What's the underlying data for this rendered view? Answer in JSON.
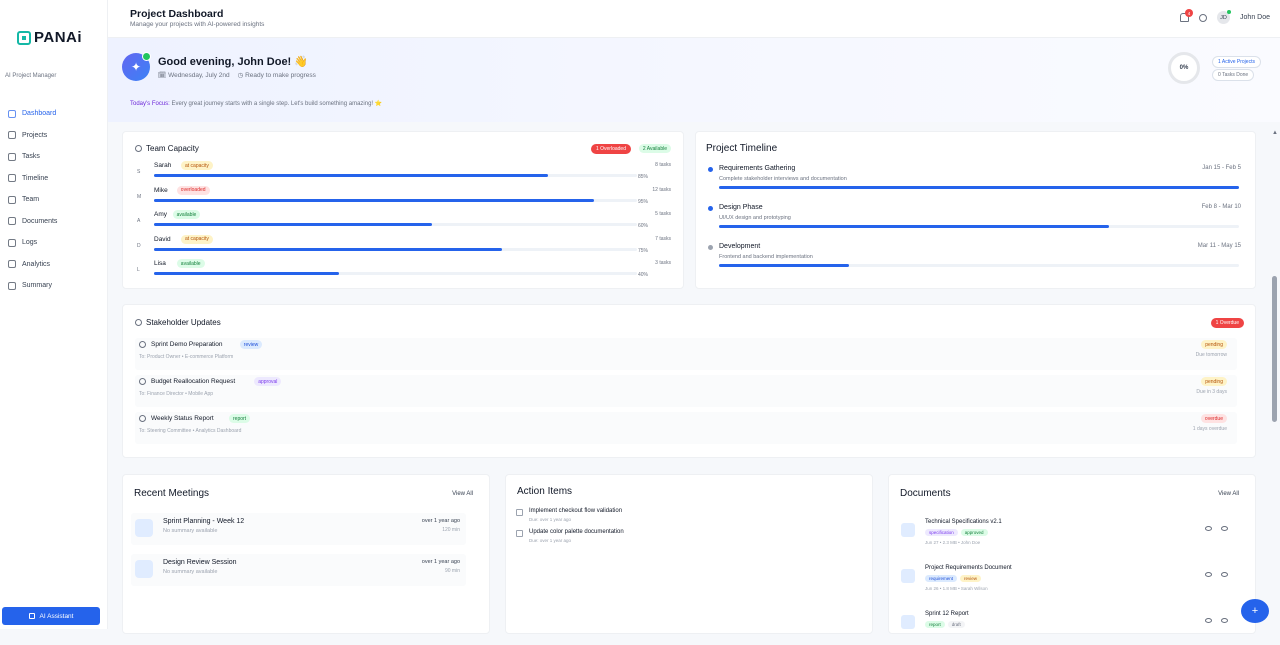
{
  "app": {
    "logo": "PANAi",
    "tagline": "AI Project Manager"
  },
  "nav": [
    {
      "label": "Dashboard",
      "active": true
    },
    {
      "label": "Projects"
    },
    {
      "label": "Tasks"
    },
    {
      "label": "Timeline"
    },
    {
      "label": "Team"
    },
    {
      "label": "Documents"
    },
    {
      "label": "Logs"
    },
    {
      "label": "Analytics"
    },
    {
      "label": "Summary"
    }
  ],
  "ai_assistant": "AI Assistant",
  "header": {
    "title": "Project Dashboard",
    "subtitle": "Manage your projects with AI-powered insights",
    "notifications": "4",
    "user_initials": "JD",
    "user_name": "John Doe"
  },
  "welcome": {
    "greeting": "Good evening, John Doe!",
    "wave": "👋",
    "date": "Wednesday, July 2nd",
    "status": "Ready to make progress",
    "focus_label": "Today's Focus:",
    "focus_text": "Every great journey starts with a single step. Let's build something amazing! ⭐",
    "progress": "0%",
    "active_projects": "1 Active Projects",
    "tasks_done": "0 Tasks Done"
  },
  "team": {
    "title": "Team Capacity",
    "overloaded": "1 Overloaded",
    "available": "2 Available",
    "members": [
      {
        "initial": "S",
        "name": "Sarah",
        "tag": "at capacity",
        "tasks": "8 tasks",
        "pct": "85%",
        "value": 85,
        "tone": "y"
      },
      {
        "initial": "M",
        "name": "Mike",
        "tag": "overloaded",
        "tasks": "12 tasks",
        "pct": "95%",
        "value": 95,
        "tone": "r"
      },
      {
        "initial": "A",
        "name": "Amy",
        "tag": "available",
        "tasks": "5 tasks",
        "pct": "60%",
        "value": 60,
        "tone": "g"
      },
      {
        "initial": "D",
        "name": "David",
        "tag": "at capacity",
        "tasks": "7 tasks",
        "pct": "75%",
        "value": 75,
        "tone": "y"
      },
      {
        "initial": "L",
        "name": "Lisa",
        "tag": "available",
        "tasks": "3 tasks",
        "pct": "40%",
        "value": 40,
        "tone": "g"
      }
    ]
  },
  "timeline": {
    "title": "Project Timeline",
    "phases": [
      {
        "name": "Requirements Gathering",
        "desc": "Complete stakeholder interviews and documentation",
        "dates": "Jan 15 - Feb 5",
        "value": 100,
        "color": "#2563eb"
      },
      {
        "name": "Design Phase",
        "desc": "UI/UX design and prototyping",
        "dates": "Feb 8 - Mar 10",
        "value": 75,
        "color": "#2563eb"
      },
      {
        "name": "Development",
        "desc": "Frontend and backend implementation",
        "dates": "Mar 11 - May 15",
        "value": 25,
        "color": "#9ca3af"
      }
    ]
  },
  "updates": {
    "title": "Stakeholder Updates",
    "overdue": "1 Overdue",
    "items": [
      {
        "name": "Sprint Demo Preparation",
        "tag": "review",
        "tone": "b",
        "to": "To: Product Owner • E-commerce Platform",
        "status": "pending",
        "due": "Due tomorrow",
        "stone": "y"
      },
      {
        "name": "Budget Reallocation Request",
        "tag": "approval",
        "tone": "p",
        "to": "To: Finance Director • Mobile App",
        "status": "pending",
        "due": "Due in 3 days",
        "stone": "y"
      },
      {
        "name": "Weekly Status Report",
        "tag": "report",
        "tone": "g",
        "to": "To: Steering Committee • Analytics Dashboard",
        "status": "overdue",
        "due": "1 days overdue",
        "stone": "r"
      }
    ]
  },
  "meetings": {
    "title": "Recent Meetings",
    "view_all": "View All",
    "items": [
      {
        "name": "Sprint Planning - Week 12",
        "sub": "No summary available",
        "when": "over 1 year ago",
        "dur": "120 min"
      },
      {
        "name": "Design Review Session",
        "sub": "No summary available",
        "when": "over 1 year ago",
        "dur": "90 min"
      }
    ]
  },
  "actions": {
    "title": "Action Items",
    "items": [
      {
        "name": "Implement checkout flow validation",
        "due": "Due: over 1 year ago"
      },
      {
        "name": "Update color palette documentation",
        "due": "Due: over 1 year ago"
      }
    ]
  },
  "documents": {
    "title": "Documents",
    "view_all": "View All",
    "items": [
      {
        "name": "Technical Specifications v2.1",
        "tags": [
          {
            "t": "specification",
            "tone": "p"
          },
          {
            "t": "approved",
            "tone": "g"
          }
        ],
        "meta": "Jun 27 • 2.3 MB • John Doe"
      },
      {
        "name": "Project Requirements Document",
        "tags": [
          {
            "t": "requirement",
            "tone": "b"
          },
          {
            "t": "review",
            "tone": "y"
          }
        ],
        "meta": "Jun 26 • 1.8 MB • Sarah Wilson"
      },
      {
        "name": "Sprint 12 Report",
        "tags": [
          {
            "t": "report",
            "tone": "g"
          },
          {
            "t": "draft",
            "tone": "gray"
          }
        ],
        "meta": ""
      }
    ]
  },
  "fab": "+"
}
